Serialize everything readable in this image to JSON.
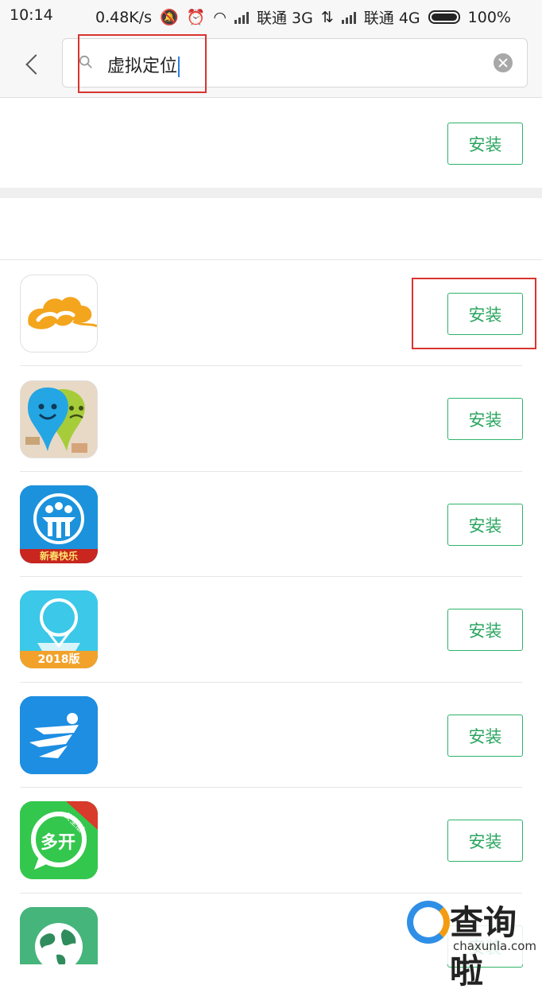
{
  "status_bar": {
    "time": "10:14",
    "speed": "0.48K/s",
    "carrier1": "联通 3G",
    "carrier2": "联通 4G",
    "battery": "100%"
  },
  "search": {
    "query": "虚拟定位"
  },
  "buttons": {
    "install_label": "安装"
  },
  "apps": [
    {
      "icon": "cloud-logo-icon"
    },
    {
      "icon": "location-pins-icon"
    },
    {
      "icon": "family-locator-icon",
      "badge": "新春快乐"
    },
    {
      "icon": "map-pin-icon",
      "badge": "2018版"
    },
    {
      "icon": "running-man-icon"
    },
    {
      "icon": "chat-bubble-icon",
      "text": "多开",
      "ribbon": "安全版"
    },
    {
      "icon": "globe-icon"
    }
  ],
  "watermark": {
    "title": "查询啦",
    "domain": "chaxunla.com"
  },
  "colors": {
    "accent_green": "#2aa55f",
    "highlight_red": "#d9342f"
  }
}
